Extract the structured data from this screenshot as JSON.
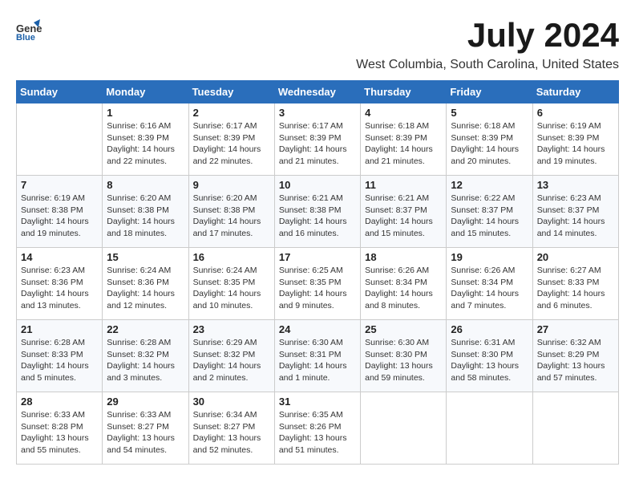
{
  "header": {
    "logo_general": "General",
    "logo_blue": "Blue",
    "month_title": "July 2024",
    "location": "West Columbia, South Carolina, United States"
  },
  "days_of_week": [
    "Sunday",
    "Monday",
    "Tuesday",
    "Wednesday",
    "Thursday",
    "Friday",
    "Saturday"
  ],
  "weeks": [
    [
      {
        "day": "",
        "info": ""
      },
      {
        "day": "1",
        "info": "Sunrise: 6:16 AM\nSunset: 8:39 PM\nDaylight: 14 hours\nand 22 minutes."
      },
      {
        "day": "2",
        "info": "Sunrise: 6:17 AM\nSunset: 8:39 PM\nDaylight: 14 hours\nand 22 minutes."
      },
      {
        "day": "3",
        "info": "Sunrise: 6:17 AM\nSunset: 8:39 PM\nDaylight: 14 hours\nand 21 minutes."
      },
      {
        "day": "4",
        "info": "Sunrise: 6:18 AM\nSunset: 8:39 PM\nDaylight: 14 hours\nand 21 minutes."
      },
      {
        "day": "5",
        "info": "Sunrise: 6:18 AM\nSunset: 8:39 PM\nDaylight: 14 hours\nand 20 minutes."
      },
      {
        "day": "6",
        "info": "Sunrise: 6:19 AM\nSunset: 8:39 PM\nDaylight: 14 hours\nand 19 minutes."
      }
    ],
    [
      {
        "day": "7",
        "info": "Sunrise: 6:19 AM\nSunset: 8:38 PM\nDaylight: 14 hours\nand 19 minutes."
      },
      {
        "day": "8",
        "info": "Sunrise: 6:20 AM\nSunset: 8:38 PM\nDaylight: 14 hours\nand 18 minutes."
      },
      {
        "day": "9",
        "info": "Sunrise: 6:20 AM\nSunset: 8:38 PM\nDaylight: 14 hours\nand 17 minutes."
      },
      {
        "day": "10",
        "info": "Sunrise: 6:21 AM\nSunset: 8:38 PM\nDaylight: 14 hours\nand 16 minutes."
      },
      {
        "day": "11",
        "info": "Sunrise: 6:21 AM\nSunset: 8:37 PM\nDaylight: 14 hours\nand 15 minutes."
      },
      {
        "day": "12",
        "info": "Sunrise: 6:22 AM\nSunset: 8:37 PM\nDaylight: 14 hours\nand 15 minutes."
      },
      {
        "day": "13",
        "info": "Sunrise: 6:23 AM\nSunset: 8:37 PM\nDaylight: 14 hours\nand 14 minutes."
      }
    ],
    [
      {
        "day": "14",
        "info": "Sunrise: 6:23 AM\nSunset: 8:36 PM\nDaylight: 14 hours\nand 13 minutes."
      },
      {
        "day": "15",
        "info": "Sunrise: 6:24 AM\nSunset: 8:36 PM\nDaylight: 14 hours\nand 12 minutes."
      },
      {
        "day": "16",
        "info": "Sunrise: 6:24 AM\nSunset: 8:35 PM\nDaylight: 14 hours\nand 10 minutes."
      },
      {
        "day": "17",
        "info": "Sunrise: 6:25 AM\nSunset: 8:35 PM\nDaylight: 14 hours\nand 9 minutes."
      },
      {
        "day": "18",
        "info": "Sunrise: 6:26 AM\nSunset: 8:34 PM\nDaylight: 14 hours\nand 8 minutes."
      },
      {
        "day": "19",
        "info": "Sunrise: 6:26 AM\nSunset: 8:34 PM\nDaylight: 14 hours\nand 7 minutes."
      },
      {
        "day": "20",
        "info": "Sunrise: 6:27 AM\nSunset: 8:33 PM\nDaylight: 14 hours\nand 6 minutes."
      }
    ],
    [
      {
        "day": "21",
        "info": "Sunrise: 6:28 AM\nSunset: 8:33 PM\nDaylight: 14 hours\nand 5 minutes."
      },
      {
        "day": "22",
        "info": "Sunrise: 6:28 AM\nSunset: 8:32 PM\nDaylight: 14 hours\nand 3 minutes."
      },
      {
        "day": "23",
        "info": "Sunrise: 6:29 AM\nSunset: 8:32 PM\nDaylight: 14 hours\nand 2 minutes."
      },
      {
        "day": "24",
        "info": "Sunrise: 6:30 AM\nSunset: 8:31 PM\nDaylight: 14 hours\nand 1 minute."
      },
      {
        "day": "25",
        "info": "Sunrise: 6:30 AM\nSunset: 8:30 PM\nDaylight: 13 hours\nand 59 minutes."
      },
      {
        "day": "26",
        "info": "Sunrise: 6:31 AM\nSunset: 8:30 PM\nDaylight: 13 hours\nand 58 minutes."
      },
      {
        "day": "27",
        "info": "Sunrise: 6:32 AM\nSunset: 8:29 PM\nDaylight: 13 hours\nand 57 minutes."
      }
    ],
    [
      {
        "day": "28",
        "info": "Sunrise: 6:33 AM\nSunset: 8:28 PM\nDaylight: 13 hours\nand 55 minutes."
      },
      {
        "day": "29",
        "info": "Sunrise: 6:33 AM\nSunset: 8:27 PM\nDaylight: 13 hours\nand 54 minutes."
      },
      {
        "day": "30",
        "info": "Sunrise: 6:34 AM\nSunset: 8:27 PM\nDaylight: 13 hours\nand 52 minutes."
      },
      {
        "day": "31",
        "info": "Sunrise: 6:35 AM\nSunset: 8:26 PM\nDaylight: 13 hours\nand 51 minutes."
      },
      {
        "day": "",
        "info": ""
      },
      {
        "day": "",
        "info": ""
      },
      {
        "day": "",
        "info": ""
      }
    ]
  ]
}
